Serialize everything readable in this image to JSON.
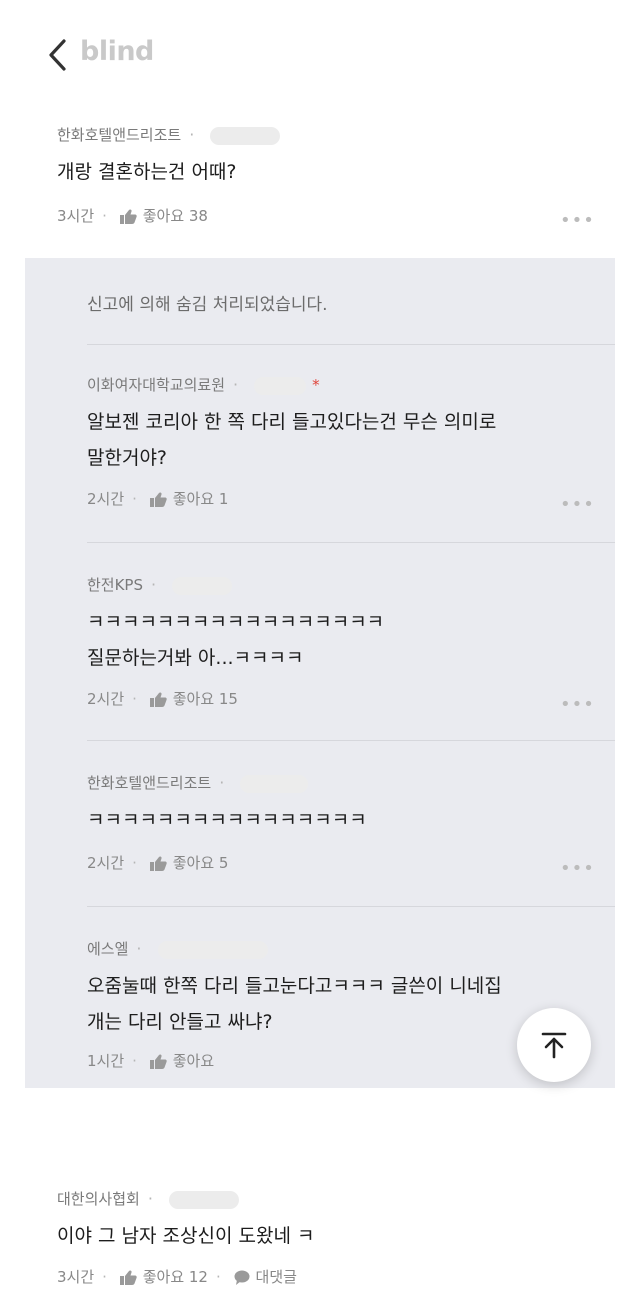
{
  "header": {
    "logo": "blind"
  },
  "post": {
    "author": "한화호텔앤드리조트",
    "title": "개랑 결혼하는건 어때?",
    "time": "3시간",
    "likes": "좋아요 38"
  },
  "comments": {
    "hidden_notice": "신고에 의해 숨김 처리되었습니다.",
    "items": [
      {
        "author": "이화여자대학교의료원",
        "star": "*",
        "lines": [
          "알보젠 코리아 한 쪽 다리 들고있다는건 무슨 의미로",
          "말한거야?"
        ],
        "time": "2시간",
        "likes": "좋아요 1"
      },
      {
        "author": "한전KPS",
        "lines": [
          "ㅋㅋㅋㅋㅋㅋㅋㅋㅋㅋㅋㅋㅋㅋㅋㅋㅋ",
          "질문하는거봐 아...ㅋㅋㅋㅋ"
        ],
        "time": "2시간",
        "likes": "좋아요 15"
      },
      {
        "author": "한화호텔앤드리조트",
        "lines": [
          "ㅋㅋㅋㅋㅋㅋㅋㅋㅋㅋㅋㅋㅋㅋㅋㅋ"
        ],
        "time": "2시간",
        "likes": "좋아요 5"
      },
      {
        "author": "에스엘",
        "lines": [
          "오줌눌때 한쪽 다리 들고눈다고ㅋㅋㅋ 글쓴이 니네집",
          "개는 다리 안들고 싸냐?"
        ],
        "time": "1시간",
        "likes": "좋아요"
      }
    ]
  },
  "next_post": {
    "author": "대한의사협회",
    "title": "이야 그 남자 조상신이 도왔네 ㅋ",
    "time": "3시간",
    "likes": "좋아요 12",
    "comments": "대댓글"
  },
  "icons": {
    "back": "chevron-left-icon",
    "like": "thumbs-up-icon",
    "more": "more-dots-icon",
    "scroll_top": "arrow-up-to-top-icon",
    "comment": "speech-bubble-icon"
  },
  "colors": {
    "comments_bg": "#eaebf0",
    "star": "#e0453b",
    "logo": "#c9c9c9"
  }
}
